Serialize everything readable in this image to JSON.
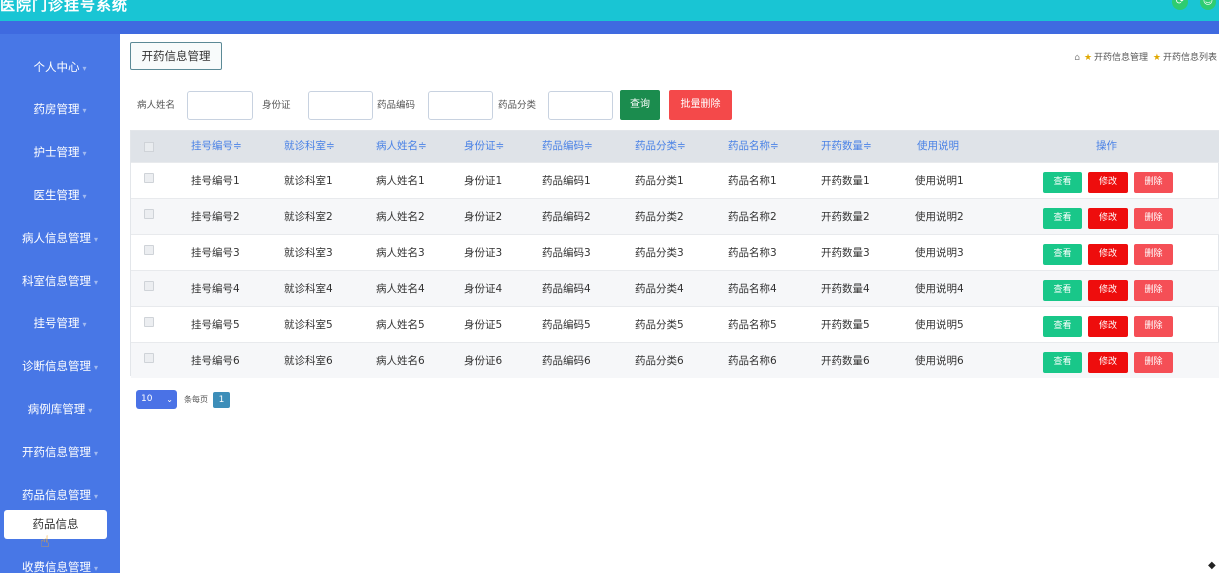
{
  "app": {
    "title": "医院门诊挂号系统"
  },
  "sidebar": {
    "items": [
      {
        "label": "个人中心"
      },
      {
        "label": "药房管理"
      },
      {
        "label": "护士管理"
      },
      {
        "label": "医生管理"
      },
      {
        "label": "病人信息管理"
      },
      {
        "label": "科室信息管理"
      },
      {
        "label": "挂号管理"
      },
      {
        "label": "诊断信息管理"
      },
      {
        "label": "病例库管理"
      },
      {
        "label": "开药信息管理"
      },
      {
        "label": "药品信息管理"
      },
      {
        "label": "收费信息管理"
      }
    ],
    "active_sub": "药品信息"
  },
  "page": {
    "tag": "开药信息管理",
    "breadcrumb": [
      "开药信息管理",
      "开药信息列表"
    ]
  },
  "search": {
    "patient_name_label": "病人姓名",
    "id_card_label": "身份证",
    "drug_code_label": "药品编码",
    "drug_category_label": "药品分类",
    "query_button": "查询",
    "batch_delete_button": "批量删除"
  },
  "table": {
    "headers": [
      "挂号编号",
      "就诊科室",
      "病人姓名",
      "身份证",
      "药品编码",
      "药品分类",
      "药品名称",
      "开药数量",
      "使用说明",
      "操作"
    ],
    "rows": [
      [
        "挂号编号1",
        "就诊科室1",
        "病人姓名1",
        "身份证1",
        "药品编码1",
        "药品分类1",
        "药品名称1",
        "开药数量1",
        "使用说明1"
      ],
      [
        "挂号编号2",
        "就诊科室2",
        "病人姓名2",
        "身份证2",
        "药品编码2",
        "药品分类2",
        "药品名称2",
        "开药数量2",
        "使用说明2"
      ],
      [
        "挂号编号3",
        "就诊科室3",
        "病人姓名3",
        "身份证3",
        "药品编码3",
        "药品分类3",
        "药品名称3",
        "开药数量3",
        "使用说明3"
      ],
      [
        "挂号编号4",
        "就诊科室4",
        "病人姓名4",
        "身份证4",
        "药品编码4",
        "药品分类4",
        "药品名称4",
        "开药数量4",
        "使用说明4"
      ],
      [
        "挂号编号5",
        "就诊科室5",
        "病人姓名5",
        "身份证5",
        "药品编码5",
        "药品分类5",
        "药品名称5",
        "开药数量5",
        "使用说明5"
      ],
      [
        "挂号编号6",
        "就诊科室6",
        "病人姓名6",
        "身份证6",
        "药品编码6",
        "药品分类6",
        "药品名称6",
        "开药数量6",
        "使用说明6"
      ]
    ],
    "actions": {
      "view": "查看",
      "edit": "修改",
      "delete": "删除"
    },
    "sort_glyph": "≑"
  },
  "pager": {
    "page_size": "10",
    "per_page_label": "条每页",
    "current_page": "1"
  },
  "colors": {
    "topbar": "#19c5d4",
    "sidebar": "#4877e6",
    "header_text": "#4a82e6",
    "query": "#1b8c4e",
    "danger": "#f4494a"
  }
}
